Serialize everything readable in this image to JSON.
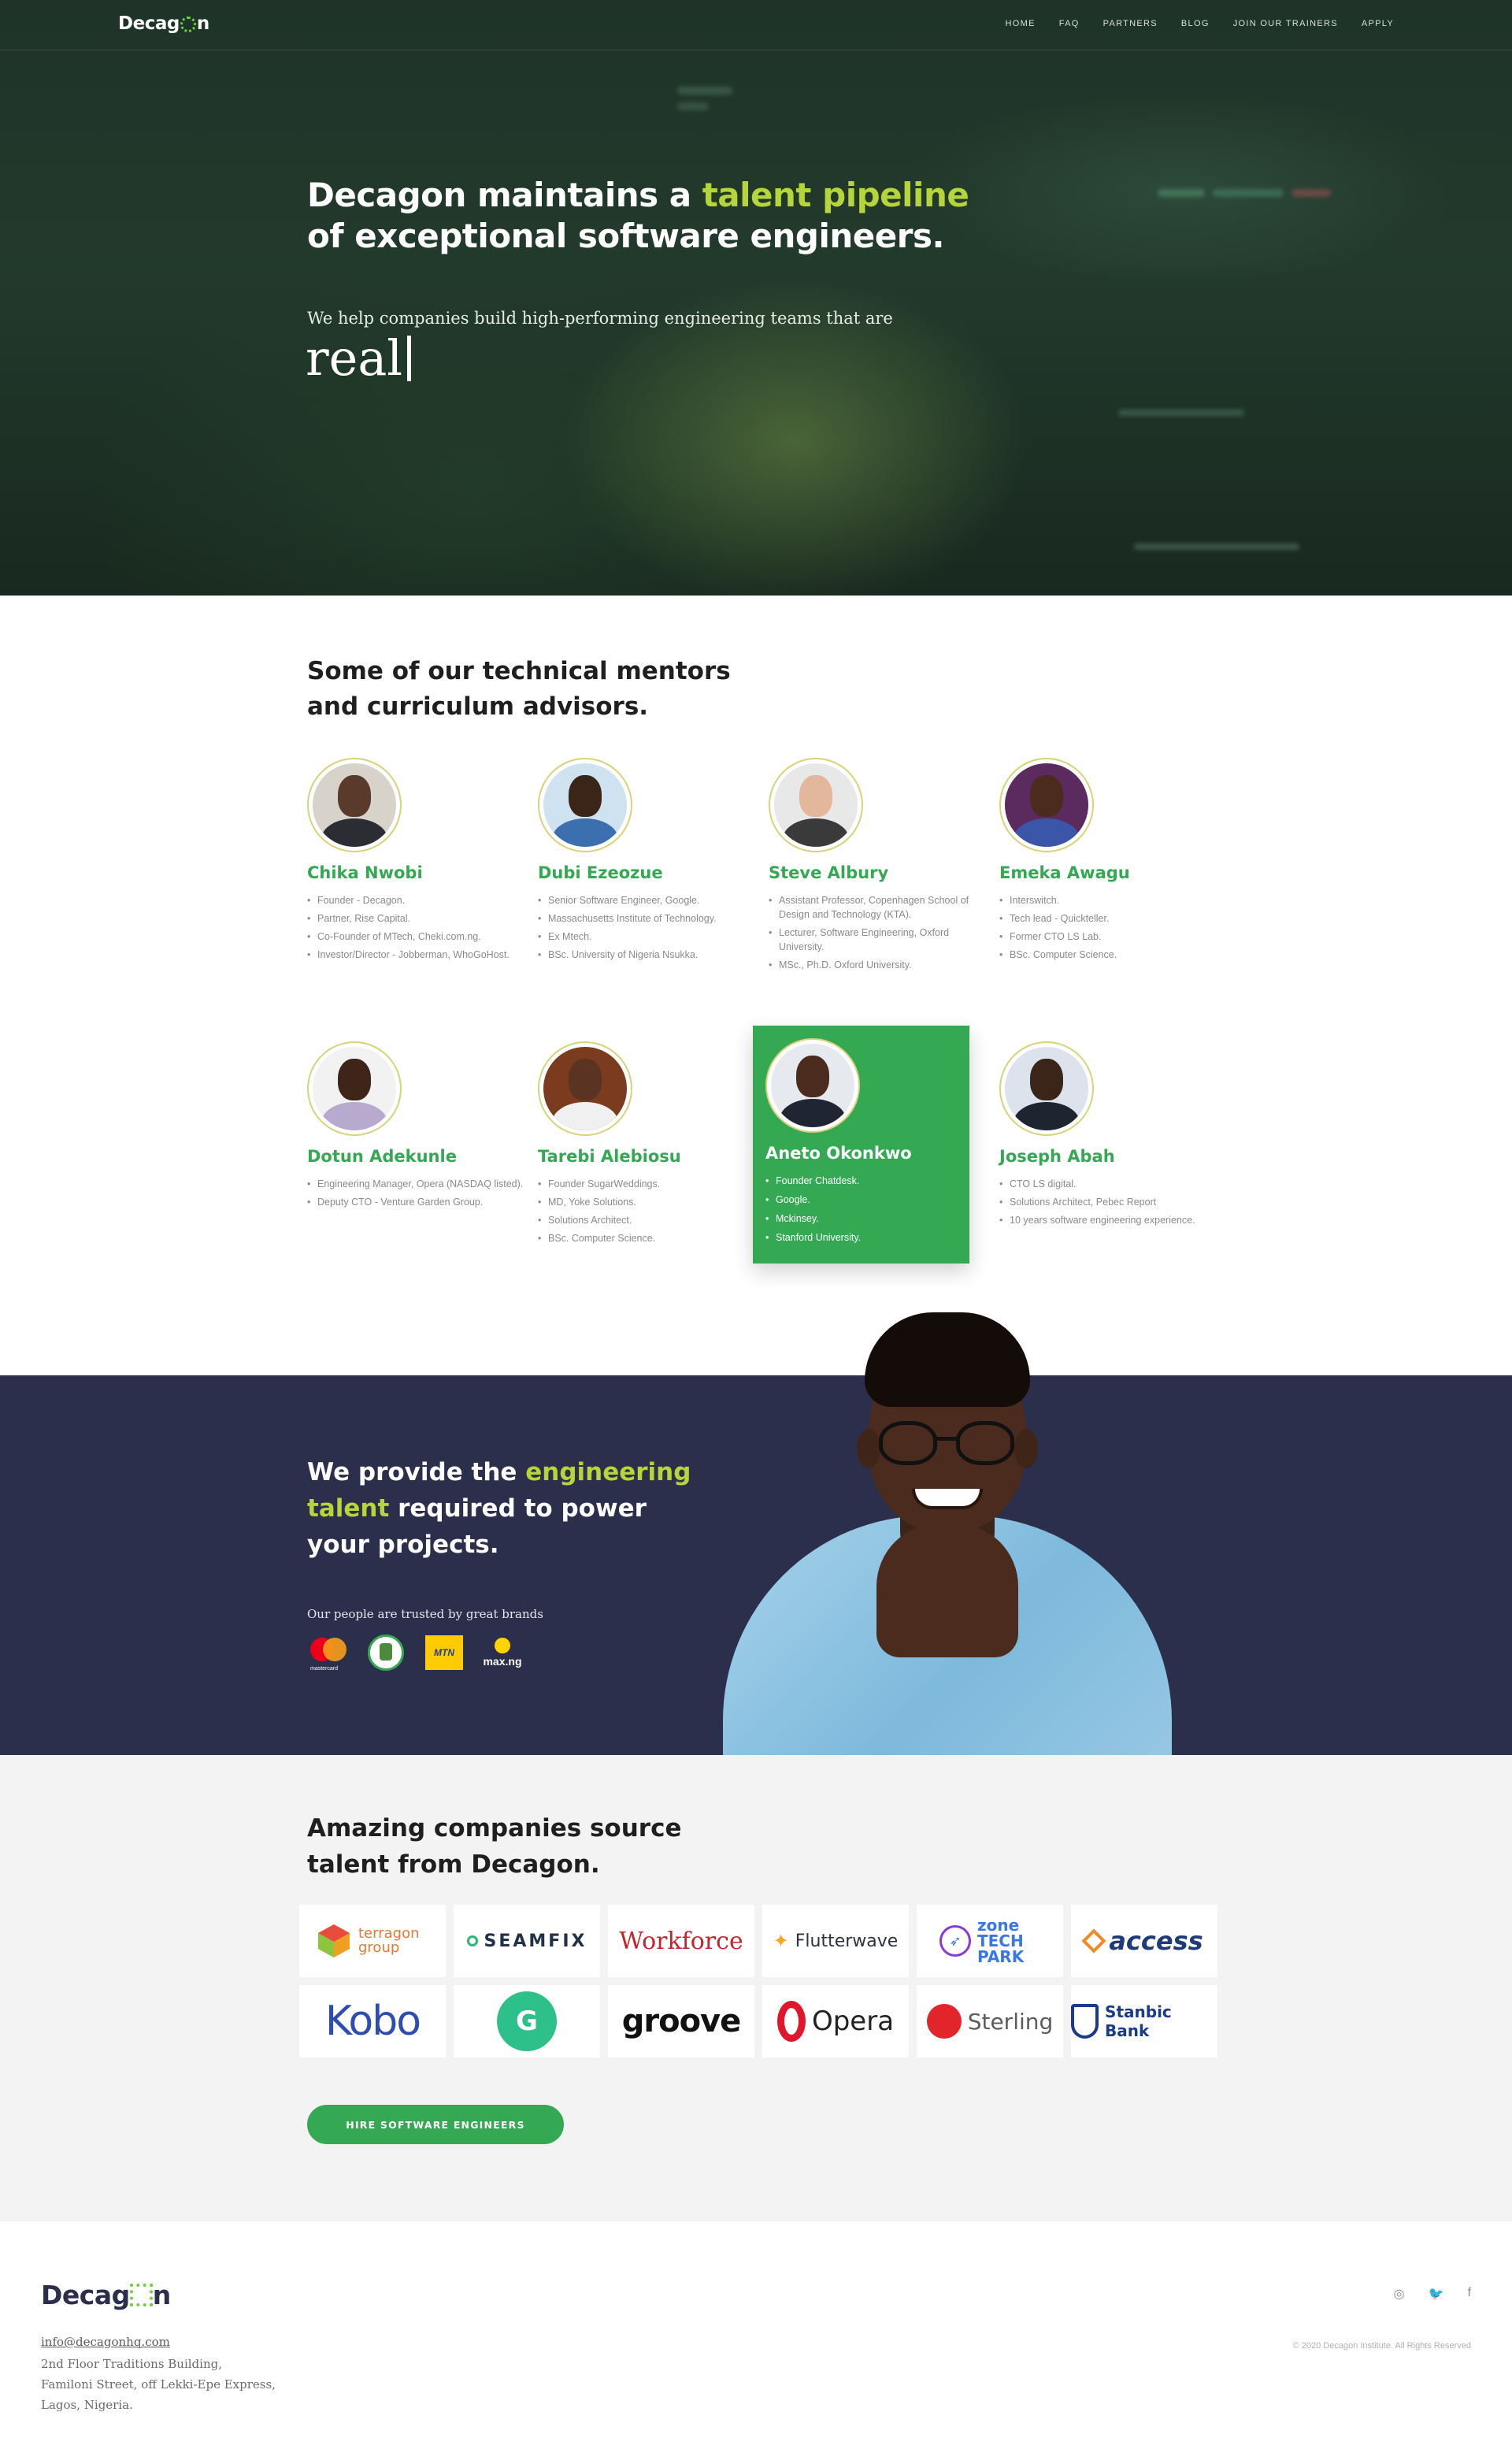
{
  "brand": {
    "logo_prefix": "Decag",
    "logo_suffix": "n"
  },
  "nav": {
    "items": [
      "HOME",
      "FAQ",
      "PARTNERS",
      "BLOG",
      "JOIN OUR TRAINERS",
      "APPLY"
    ]
  },
  "hero": {
    "title_pre": "Decagon maintains a ",
    "title_accent": "talent pipeline",
    "title_post": "of exceptional software engineers.",
    "subtitle": "We help companies build high-performing engineering teams that are",
    "typed_word": "real"
  },
  "mentors": {
    "heading": "Some of our technical mentors and curriculum advisors.",
    "people": [
      {
        "name": "Chika Nwobi",
        "bullets": [
          "Founder - Decagon.",
          "Partner, Rise Capital.",
          "Co-Founder of MTech, Cheki.com.ng.",
          "Investor/Director - Jobberman, WhoGoHost."
        ]
      },
      {
        "name": "Dubi Ezeozue",
        "bullets": [
          "Senior Software Engineer, Google.",
          "Massachusetts Institute of Technology.",
          "Ex Mtech.",
          "BSc. University of Nigeria Nsukka."
        ]
      },
      {
        "name": "Steve Albury",
        "bullets": [
          "Assistant Professor, Copenhagen School of Design and Technology (KTA).",
          "Lecturer, Software Engineering, Oxford University.",
          "MSc., Ph.D. Oxford University."
        ]
      },
      {
        "name": "Emeka Awagu",
        "bullets": [
          "Interswitch.",
          "Tech lead - Quickteller.",
          "Former CTO LS Lab.",
          "BSc. Computer Science."
        ]
      },
      {
        "name": "Dotun Adekunle",
        "bullets": [
          "Engineering Manager, Opera (NASDAQ listed).",
          "Deputy CTO - Venture Garden Group."
        ]
      },
      {
        "name": "Tarebi Alebiosu",
        "bullets": [
          "Founder SugarWeddings.",
          "MD, Yoke Solutions.",
          "Solutions Architect.",
          "BSc. Computer Science."
        ]
      },
      {
        "name": "Aneto Okonkwo",
        "bullets": [
          "Founder Chatdesk.",
          "Google.",
          "Mckinsey.",
          "Stanford University."
        ]
      },
      {
        "name": "Joseph Abah",
        "bullets": [
          "CTO LS digital.",
          "Solutions Architect, Pebec Report",
          "10 years software engineering experience."
        ]
      }
    ]
  },
  "provide": {
    "h_pre": "We provide the ",
    "h_accent": "engineering talent",
    "h_post": " required to power your projects.",
    "trusted": "Our people are trusted by great brands",
    "brands": {
      "mastercard": "mastercard",
      "mtn": "MTN",
      "maxng": "max.ng"
    }
  },
  "companies": {
    "heading": "Amazing companies source talent from Decagon.",
    "logos": [
      "terragon group",
      "SEAMFIX",
      "Workforce",
      "Flutterwave",
      "zone TECH PARK",
      "access",
      "Kobo",
      "G",
      "groove",
      "Opera",
      "Sterling",
      "Stanbic Bank"
    ],
    "cta": "HIRE SOFTWARE ENGINEERS"
  },
  "footer": {
    "email": "info@decagonhq.com",
    "address_lines": [
      "2nd Floor Traditions Building,",
      "Familoni Street, off Lekki-Epe Express,",
      "Lagos, Nigeria."
    ],
    "copyright": "© 2020 Decagon Institute. All Rights Reserved",
    "social": {
      "instagram": "◎",
      "twitter": "🐦",
      "facebook": "f"
    }
  },
  "colors": {
    "green": "#34a853",
    "lime": "#b5d53b",
    "navy": "#2c2f4b",
    "hero_bg": "#1f3328",
    "light_bg": "#f3f3f3"
  }
}
